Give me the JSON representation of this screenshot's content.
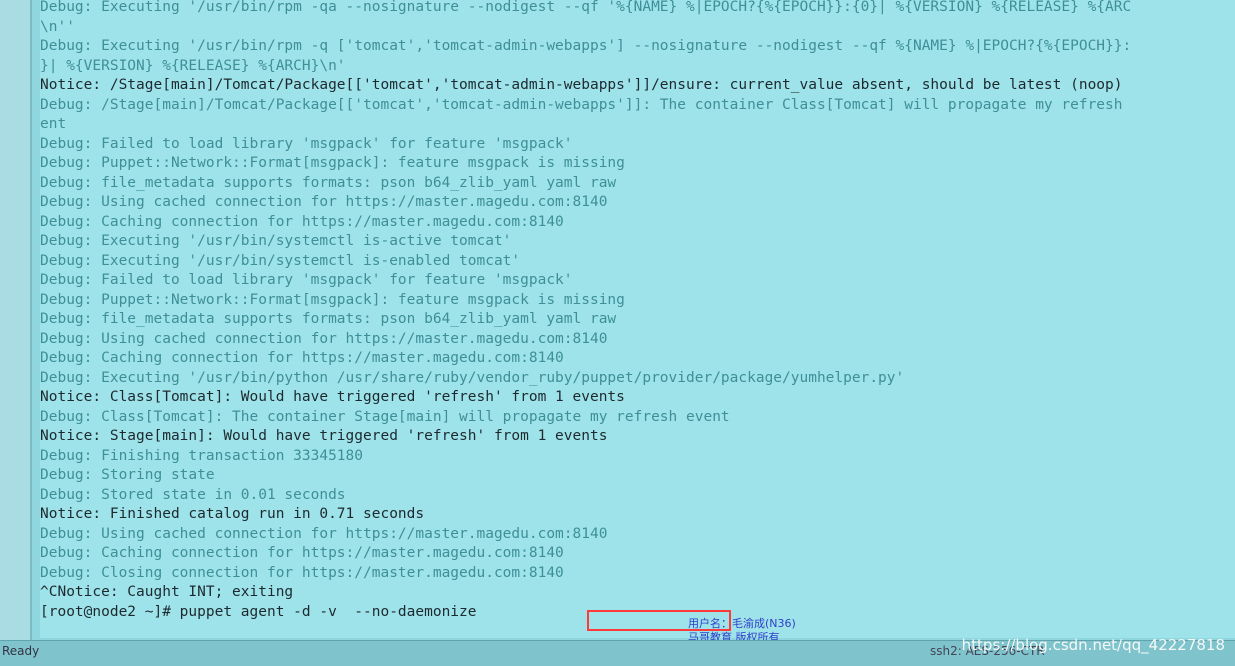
{
  "terminal": {
    "lines": [
      {
        "type": "debug",
        "text": "Debug: Executing '/usr/bin/rpm -qa --nosignature --nodigest --qf '%{NAME} %|EPOCH?{%{EPOCH}}:{0}| %{VERSION} %{RELEASE} %{ARC"
      },
      {
        "type": "debug",
        "text": "\\n''"
      },
      {
        "type": "debug",
        "text": "Debug: Executing '/usr/bin/rpm -q ['tomcat','tomcat-admin-webapps'] --nosignature --nodigest --qf %{NAME} %|EPOCH?{%{EPOCH}}:"
      },
      {
        "type": "debug",
        "text": "}| %{VERSION} %{RELEASE} %{ARCH}\\n'"
      },
      {
        "type": "notice",
        "text": "Notice: /Stage[main]/Tomcat/Package[['tomcat','tomcat-admin-webapps']]/ensure: current_value absent, should be latest (noop)"
      },
      {
        "type": "debug",
        "text": "Debug: /Stage[main]/Tomcat/Package[['tomcat','tomcat-admin-webapps']]: The container Class[Tomcat] will propagate my refresh"
      },
      {
        "type": "debug",
        "text": "ent"
      },
      {
        "type": "debug",
        "text": "Debug: Failed to load library 'msgpack' for feature 'msgpack'"
      },
      {
        "type": "debug",
        "text": "Debug: Puppet::Network::Format[msgpack]: feature msgpack is missing"
      },
      {
        "type": "debug",
        "text": "Debug: file_metadata supports formats: pson b64_zlib_yaml yaml raw"
      },
      {
        "type": "debug",
        "text": "Debug: Using cached connection for https://master.magedu.com:8140"
      },
      {
        "type": "debug",
        "text": "Debug: Caching connection for https://master.magedu.com:8140"
      },
      {
        "type": "debug",
        "text": "Debug: Executing '/usr/bin/systemctl is-active tomcat'"
      },
      {
        "type": "debug",
        "text": "Debug: Executing '/usr/bin/systemctl is-enabled tomcat'"
      },
      {
        "type": "debug",
        "text": "Debug: Failed to load library 'msgpack' for feature 'msgpack'"
      },
      {
        "type": "debug",
        "text": "Debug: Puppet::Network::Format[msgpack]: feature msgpack is missing"
      },
      {
        "type": "debug",
        "text": "Debug: file_metadata supports formats: pson b64_zlib_yaml yaml raw"
      },
      {
        "type": "debug",
        "text": "Debug: Using cached connection for https://master.magedu.com:8140"
      },
      {
        "type": "debug",
        "text": "Debug: Caching connection for https://master.magedu.com:8140"
      },
      {
        "type": "debug",
        "text": "Debug: Executing '/usr/bin/python /usr/share/ruby/vendor_ruby/puppet/provider/package/yumhelper.py'"
      },
      {
        "type": "notice",
        "text": "Notice: Class[Tomcat]: Would have triggered 'refresh' from 1 events"
      },
      {
        "type": "debug",
        "text": "Debug: Class[Tomcat]: The container Stage[main] will propagate my refresh event"
      },
      {
        "type": "notice",
        "text": "Notice: Stage[main]: Would have triggered 'refresh' from 1 events"
      },
      {
        "type": "debug",
        "text": "Debug: Finishing transaction 33345180"
      },
      {
        "type": "debug",
        "text": "Debug: Storing state"
      },
      {
        "type": "debug",
        "text": "Debug: Stored state in 0.01 seconds"
      },
      {
        "type": "notice",
        "text": "Notice: Finished catalog run in 0.71 seconds"
      },
      {
        "type": "debug",
        "text": "Debug: Using cached connection for https://master.magedu.com:8140"
      },
      {
        "type": "debug",
        "text": "Debug: Caching connection for https://master.magedu.com:8140"
      },
      {
        "type": "debug",
        "text": "Debug: Closing connection for https://master.magedu.com:8140"
      },
      {
        "type": "plain",
        "text": "^CNotice: Caught INT; exiting"
      },
      {
        "type": "plain",
        "text": "[root@node2 ~]# puppet agent -d -v  --no-daemonize"
      }
    ]
  },
  "statusbar": {
    "ready": "Ready",
    "connection": "ssh2: AES-256-CTR"
  },
  "watermark": {
    "line1": "用户名：毛渝成(N36)",
    "line2": "马哥教育 版权所有",
    "url": "https://blog.csdn.net/qq_42227818"
  },
  "colors": {
    "debug": "#3f8f98",
    "notice": "#1c2a30",
    "highlight_box": "#ff3a3a"
  }
}
